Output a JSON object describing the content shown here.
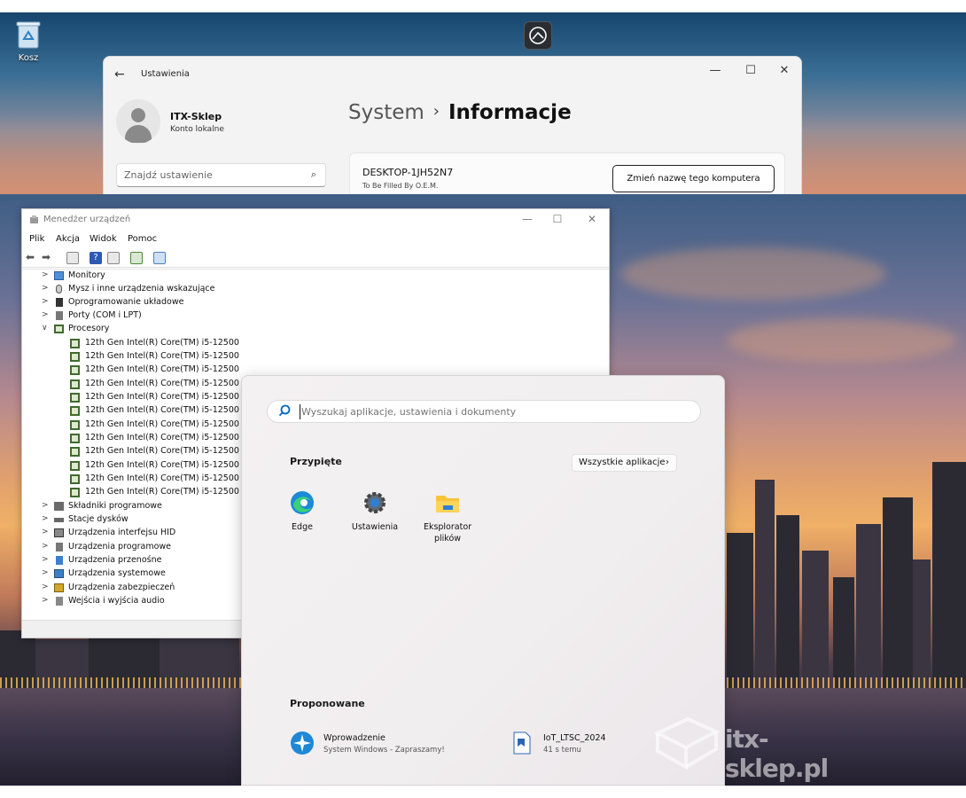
{
  "desktop": {
    "recycle_bin_label": "Kosz"
  },
  "settings": {
    "window_title": "Ustawienia",
    "back_glyph": "←",
    "controls": {
      "minimize": "—",
      "maximize": "☐",
      "close": "✕"
    },
    "profile": {
      "name": "ITX-Sklep",
      "subtitle": "Konto lokalne"
    },
    "search_placeholder": "Znajdź ustawienie",
    "breadcrumb": {
      "parent": "System",
      "separator": "›",
      "current": "Informacje"
    },
    "device": {
      "name": "DESKTOP-1JH52N7",
      "model": "To Be Filled By O.E.M."
    },
    "rename_button": "Zmień nazwę tego komputera"
  },
  "device_manager": {
    "window_title": "Menedżer urządzeń",
    "controls": {
      "minimize": "—",
      "maximize": "☐",
      "close": "✕"
    },
    "menu": [
      "Plik",
      "Akcja",
      "Widok",
      "Pomoc"
    ],
    "tree_before": [
      {
        "label": "Monitory",
        "icon": "monitor-icon"
      },
      {
        "label": "Mysz i inne urządzenia wskazujące",
        "icon": "mouse-icon"
      },
      {
        "label": "Oprogramowanie układowe",
        "icon": "firmware-icon"
      },
      {
        "label": "Porty (COM i LPT)",
        "icon": "port-icon"
      }
    ],
    "expanded_category": {
      "label": "Procesory",
      "icon": "processor-icon"
    },
    "processors": [
      "12th Gen Intel(R) Core(TM) i5-12500",
      "12th Gen Intel(R) Core(TM) i5-12500",
      "12th Gen Intel(R) Core(TM) i5-12500",
      "12th Gen Intel(R) Core(TM) i5-12500",
      "12th Gen Intel(R) Core(TM) i5-12500",
      "12th Gen Intel(R) Core(TM) i5-12500",
      "12th Gen Intel(R) Core(TM) i5-12500",
      "12th Gen Intel(R) Core(TM) i5-12500",
      "12th Gen Intel(R) Core(TM) i5-12500",
      "12th Gen Intel(R) Core(TM) i5-12500",
      "12th Gen Intel(R) Core(TM) i5-12500",
      "12th Gen Intel(R) Core(TM) i5-12500"
    ],
    "tree_after": [
      {
        "label": "Składniki programowe",
        "icon": "software-component-icon"
      },
      {
        "label": "Stacje dysków",
        "icon": "disk-drive-icon"
      },
      {
        "label": "Urządzenia interfejsu HID",
        "icon": "hid-icon"
      },
      {
        "label": "Urządzenia programowe",
        "icon": "software-device-icon"
      },
      {
        "label": "Urządzenia przenośne",
        "icon": "portable-device-icon"
      },
      {
        "label": "Urządzenia systemowe",
        "icon": "system-device-icon"
      },
      {
        "label": "Urządzenia zabezpieczeń",
        "icon": "security-device-icon"
      },
      {
        "label": "Wejścia i wyjścia audio",
        "icon": "audio-icon"
      }
    ]
  },
  "start_menu": {
    "search_placeholder": "Wyszukaj aplikacje, ustawienia i dokumenty",
    "pinned_title": "Przypięte",
    "all_apps_label": "Wszystkie aplikacje",
    "all_apps_chevron": "›",
    "pinned": [
      {
        "label": "Edge",
        "icon": "edge-icon"
      },
      {
        "label": "Ustawienia",
        "icon": "settings-gear-icon"
      },
      {
        "label": "Eksplorator plików",
        "icon": "file-explorer-icon"
      }
    ],
    "recommended_title": "Proponowane",
    "recommended": [
      {
        "name": "Wprowadzenie",
        "subtitle": "System Windows - Zapraszamy!",
        "icon": "get-started-icon"
      },
      {
        "name": "IoT_LTSC_2024",
        "subtitle": "41 s temu",
        "icon": "document-icon"
      }
    ]
  },
  "watermark": {
    "text": "itx-sklep.pl"
  },
  "colors": {
    "accent": "#0067c0",
    "processor_green": "#3f6b2e",
    "edge_blue": "#1c8ad8",
    "folder_yellow": "#f7c33a"
  }
}
